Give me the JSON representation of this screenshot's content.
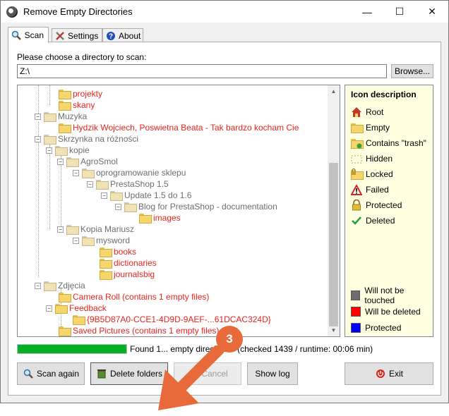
{
  "window": {
    "title": "Remove Empty Directories",
    "minimize": "—",
    "maximize": "☐",
    "close": "✕"
  },
  "tabs": [
    {
      "label": "Scan",
      "icon": "magnifier-icon",
      "active": true
    },
    {
      "label": "Settings",
      "icon": "tools-icon",
      "active": false
    },
    {
      "label": "About",
      "icon": "help-icon",
      "active": false
    }
  ],
  "scan": {
    "prompt": "Please choose a directory to scan:",
    "path_value": "Z:\\",
    "browse_label": "Browse..."
  },
  "tree": [
    {
      "label": "projekty",
      "color": "red"
    },
    {
      "label": "skany",
      "color": "red"
    },
    {
      "label": "Muzyka",
      "color": "gray"
    },
    {
      "label": "Hydzik Wojciech, Poswietna Beata - Tak bardzo kocham Cie",
      "color": "red"
    },
    {
      "label": "Skrzynka na różności",
      "color": "gray"
    },
    {
      "label": "kopie",
      "color": "gray"
    },
    {
      "label": "AgroSmol",
      "color": "gray"
    },
    {
      "label": "oprogramowanie sklepu",
      "color": "gray"
    },
    {
      "label": "PrestaShop 1.5",
      "color": "gray"
    },
    {
      "label": "Update 1.5 do 1.6",
      "color": "gray"
    },
    {
      "label": "Blog for PrestaShop - documentation",
      "color": "gray"
    },
    {
      "label": "images",
      "color": "red"
    },
    {
      "label": "Kopia Mariusz",
      "color": "gray"
    },
    {
      "label": "mysword",
      "color": "gray"
    },
    {
      "label": "books",
      "color": "red"
    },
    {
      "label": "dictionaries",
      "color": "red"
    },
    {
      "label": "journalsbig",
      "color": "red"
    },
    {
      "label": "Zdjęcia",
      "color": "gray"
    },
    {
      "label": "Camera Roll (contains 1 empty files)",
      "color": "red"
    },
    {
      "label": "Feedback",
      "color": "red"
    },
    {
      "label": "{9B5D87A0-CCE1-4D9D-9AEF-...61DCAC324D}",
      "color": "red"
    },
    {
      "label": "Saved Pictures (contains 1 empty files)",
      "color": "red"
    }
  ],
  "legend": {
    "title": "Icon description",
    "items": [
      {
        "label": "Root",
        "icon": "house-icon"
      },
      {
        "label": "Empty",
        "icon": "folder-icon"
      },
      {
        "label": "Contains \"trash\"",
        "icon": "trash-folder-icon"
      },
      {
        "label": "Hidden",
        "icon": "hidden-folder-icon"
      },
      {
        "label": "Locked",
        "icon": "locked-folder-icon"
      },
      {
        "label": "Failed",
        "icon": "warning-icon"
      },
      {
        "label": "Protected",
        "icon": "lock-icon"
      },
      {
        "label": "Deleted",
        "icon": "checkmark-icon"
      }
    ],
    "colors": [
      {
        "label": "Will not be touched",
        "color": "#6d6d6d"
      },
      {
        "label": "Will be deleted",
        "color": "#ff0000"
      },
      {
        "label": "Protected",
        "color": "#0000ff"
      }
    ]
  },
  "progress": {
    "percent": 100,
    "color": "#06b025"
  },
  "status_text": "Found 1... empty directories (checked 1439 / runtime: 00:06 min)",
  "buttons": {
    "scan_again": "Scan again",
    "delete_folders": "Delete folders",
    "cancel": "Cancel",
    "show_log": "Show log",
    "exit": "Exit"
  },
  "callout": {
    "number": "3",
    "color": "#e86a3a"
  }
}
